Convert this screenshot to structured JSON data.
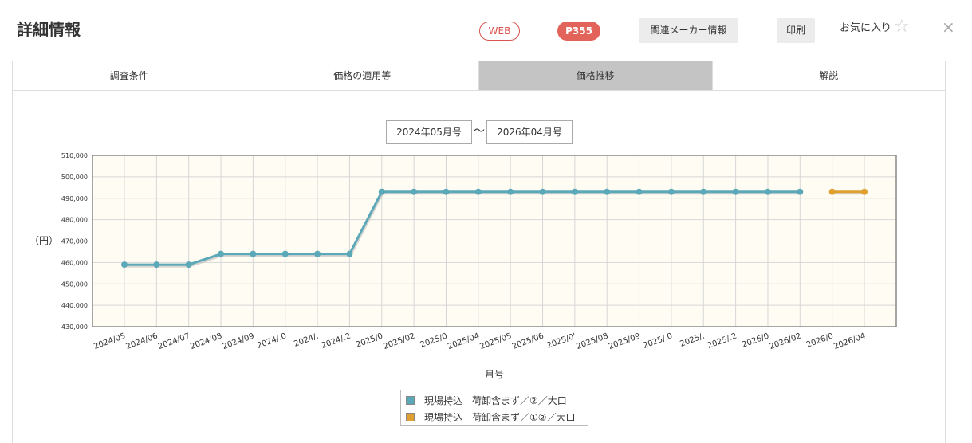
{
  "header": {
    "title": "詳細情報",
    "badge_web": "WEB",
    "badge_code": "P355",
    "maker_button": "関連メーカー情報",
    "print_button": "印刷",
    "favorite_label": "お気に入り",
    "star_glyph": "☆",
    "close_glyph": "×"
  },
  "tabs": [
    {
      "label": "調査条件",
      "active": false
    },
    {
      "label": "価格の適用等",
      "active": false
    },
    {
      "label": "価格推移",
      "active": true
    },
    {
      "label": "解説",
      "active": false
    }
  ],
  "range": {
    "from": "2024年05月号",
    "separator": "～",
    "to": "2026年04月号"
  },
  "chart_data": {
    "type": "line",
    "ylabel": "（円）",
    "xlabel": "月号",
    "ylim": [
      430000,
      510000
    ],
    "yticks": [
      "430,000",
      "440,000",
      "450,000",
      "460,000",
      "470,000",
      "480,000",
      "490,000",
      "500,000",
      "510,000"
    ],
    "categories": [
      "2024/05",
      "2024/06",
      "2024/07",
      "2024/08",
      "2024/09",
      "2024/.0",
      "2024/.",
      "2024/.2",
      "2025/0",
      "2025/02",
      "2025/0",
      "2025/04",
      "2025/05",
      "2025/06",
      "2025/0'",
      "2025/08",
      "2025/09",
      "2025/.0",
      "2025/.",
      "2025/.2",
      "2026/0",
      "2026/02",
      "2026/0",
      "2026/04"
    ],
    "grid": true,
    "legend_position": "bottom",
    "series": [
      {
        "name": "現場持込　荷卸含まず／②／大口",
        "color": "#5ba8b8",
        "values": [
          459000,
          459000,
          459000,
          464000,
          464000,
          464000,
          464000,
          464000,
          493000,
          493000,
          493000,
          493000,
          493000,
          493000,
          493000,
          493000,
          493000,
          493000,
          493000,
          493000,
          493000,
          493000,
          null,
          null
        ]
      },
      {
        "name": "現場持込　荷卸含まず／①②／大口",
        "color": "#e0a030",
        "values": [
          null,
          null,
          null,
          null,
          null,
          null,
          null,
          null,
          null,
          null,
          null,
          null,
          null,
          null,
          null,
          null,
          null,
          null,
          null,
          null,
          null,
          null,
          493000,
          493000
        ]
      }
    ]
  }
}
